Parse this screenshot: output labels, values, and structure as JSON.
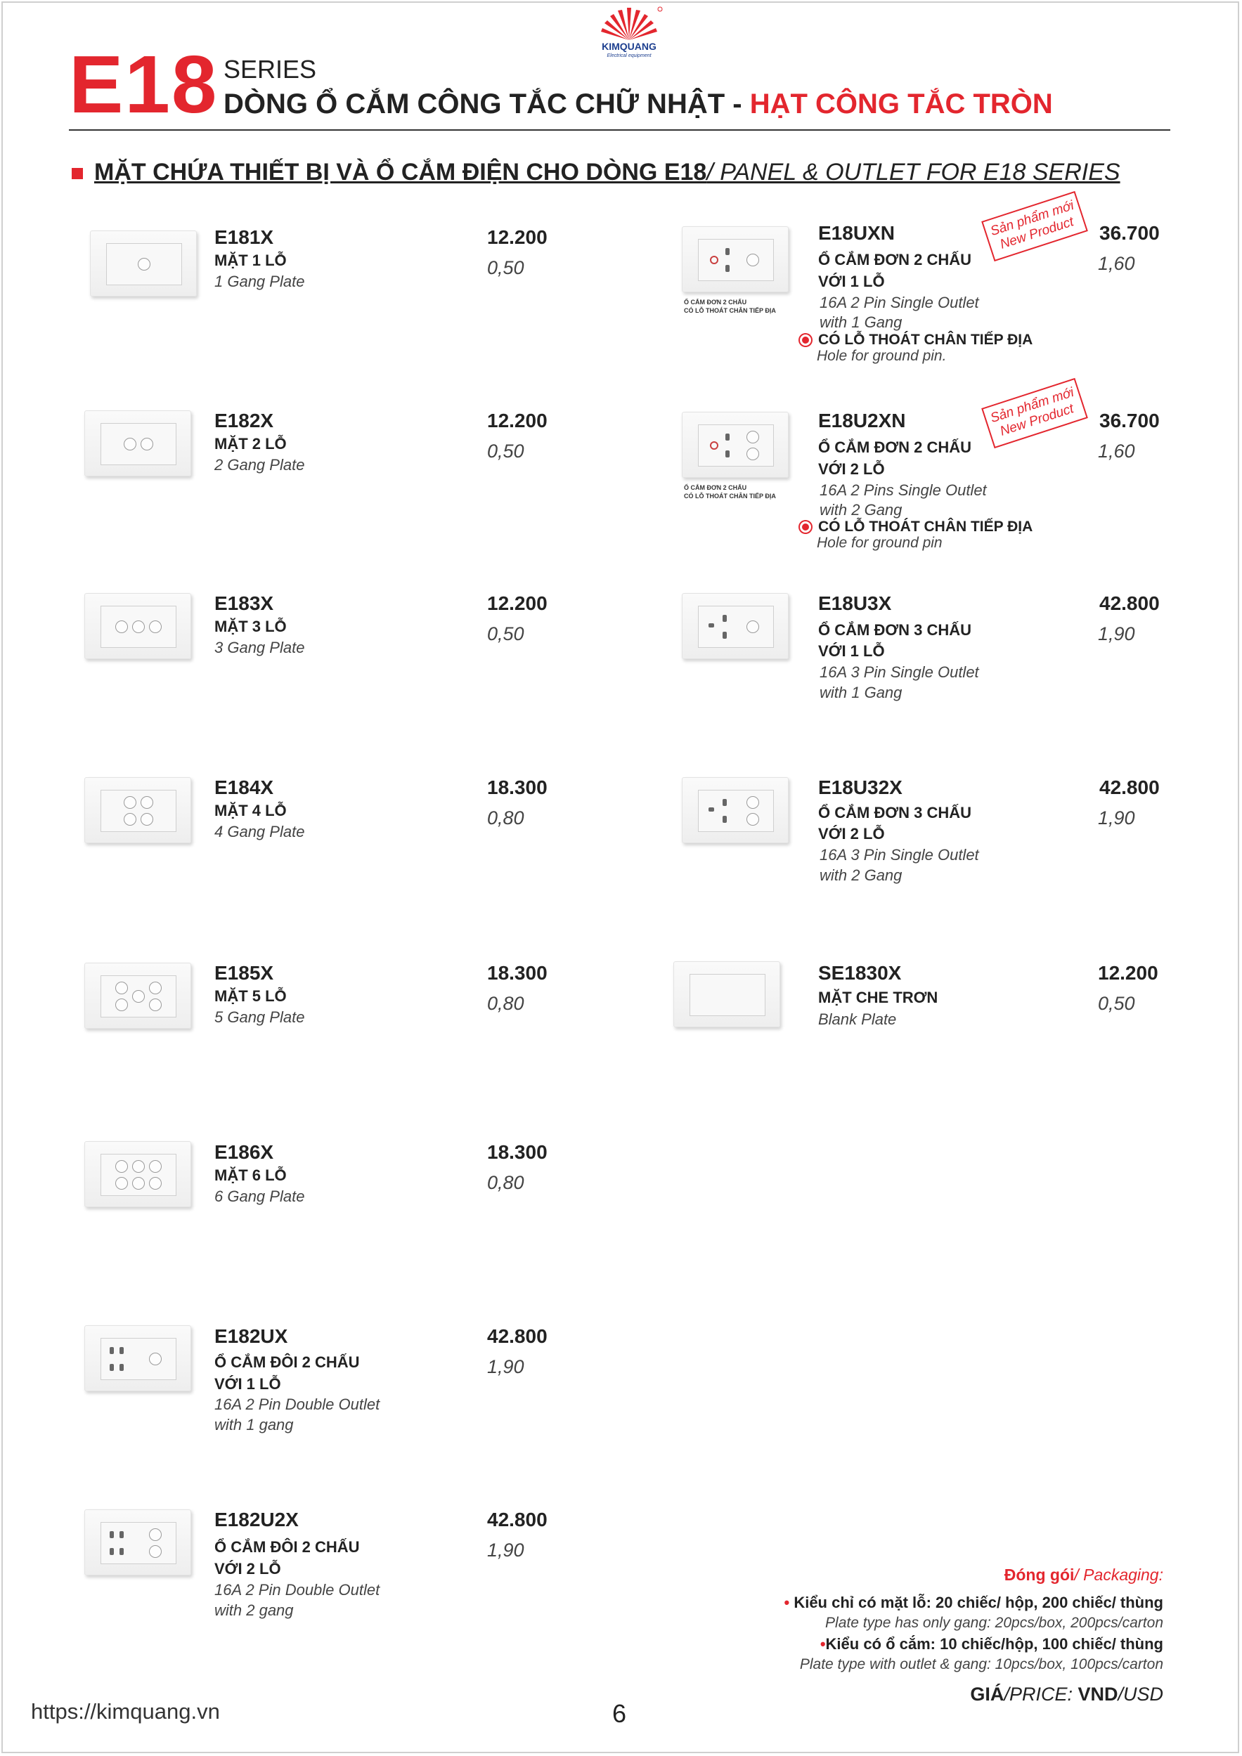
{
  "header": {
    "brand": "KIMQUANG",
    "brand_tagline": "Electrical equipment",
    "series_code": "E18",
    "series_word": "SERIES",
    "title_main": "DÒNG Ổ CẮM CÔNG TẮC CHỮ NHẬT - ",
    "title_accent": "HẠT CÔNG TẮC TRÒN"
  },
  "section": {
    "title_vn": "MẶT CHỨA THIẾT BỊ VÀ Ổ CẮM ĐIỆN CHO DÒNG E18",
    "title_en": "/ PANEL & OUTLET FOR E18 SERIES"
  },
  "products_left": [
    {
      "code": "E181X",
      "name_vn": "MẶT 1 LỖ",
      "name_en": "1 Gang Plate",
      "price": "12.200",
      "usd": "0,50"
    },
    {
      "code": "E182X",
      "name_vn": "MẶT 2 LỖ",
      "name_en": "2 Gang Plate",
      "price": "12.200",
      "usd": "0,50"
    },
    {
      "code": "E183X",
      "name_vn": "MẶT 3 LỖ",
      "name_en": "3 Gang Plate",
      "price": "12.200",
      "usd": "0,50"
    },
    {
      "code": "E184X",
      "name_vn": "MẶT 4 LỖ",
      "name_en": "4 Gang Plate",
      "price": "18.300",
      "usd": "0,80"
    },
    {
      "code": "E185X",
      "name_vn": "MẶT 5 LỖ",
      "name_en": "5 Gang Plate",
      "price": "18.300",
      "usd": "0,80"
    },
    {
      "code": "E186X",
      "name_vn": "MẶT 6 LỖ",
      "name_en": "6 Gang Plate",
      "price": "18.300",
      "usd": "0,80"
    },
    {
      "code": "E182UX",
      "name_vn_1": "Ổ CẮM ĐÔI 2 CHẤU",
      "name_vn_2": "VỚI 1 LỖ",
      "name_en_1": "16A 2 Pin Double Outlet",
      "name_en_2": "with 1 gang",
      "price": "42.800",
      "usd": "1,90"
    },
    {
      "code": "E182U2X",
      "name_vn_1": "Ổ CẮM ĐÔI 2 CHẤU",
      "name_vn_2": "VỚI 2 LỖ",
      "name_en_1": "16A 2 Pin Double Outlet",
      "name_en_2": "with 2 gang",
      "price": "42.800",
      "usd": "1,90"
    }
  ],
  "products_right": [
    {
      "code": "E18UXN",
      "name_vn_1": "Ổ CẮM ĐƠN 2 CHẤU",
      "name_vn_2": "VỚI 1 LỖ",
      "name_en_1": "16A 2 Pin Single Outlet",
      "name_en_2": "with 1 Gang",
      "price": "36.700",
      "usd": "1,60",
      "caption_1": "Ổ CẮM ĐƠN 2 CHẤU",
      "caption_2": "CÓ LỖ THOÁT CHÂN TIẾP ĐỊA",
      "ground_vn": "CÓ LỖ THOÁT CHÂN TIẾP ĐỊA",
      "ground_en": "Hole for ground pin.",
      "stamp_1": "Sản phẩm mới",
      "stamp_2": "New Product"
    },
    {
      "code": "E18U2XN",
      "name_vn_1": "Ổ CẮM ĐƠN 2 CHẤU",
      "name_vn_2": "VỚI 2 LỖ",
      "name_en_1": "16A 2 Pins Single Outlet",
      "name_en_2": "with 2 Gang",
      "price": "36.700",
      "usd": "1,60",
      "caption_1": "Ổ CẮM ĐƠN 2 CHẤU",
      "caption_2": "CÓ LỖ THOÁT CHÂN TIẾP ĐỊA",
      "ground_vn": "CÓ LỖ THOÁT CHÂN TIẾP ĐỊA",
      "ground_en": "Hole for ground pin",
      "stamp_1": "Sản phẩm mới",
      "stamp_2": "New Product"
    },
    {
      "code": "E18U3X",
      "name_vn_1": "Ổ CẮM ĐƠN 3 CHẤU",
      "name_vn_2": "VỚI 1 LỖ",
      "name_en_1": "16A 3 Pin Single Outlet",
      "name_en_2": "with 1 Gang",
      "price": "42.800",
      "usd": "1,90"
    },
    {
      "code": "E18U32X",
      "name_vn_1": "Ổ CẮM ĐƠN 3 CHẤU",
      "name_vn_2": "VỚI 2 LỖ",
      "name_en_1": "16A 3 Pin Single Outlet",
      "name_en_2": "with 2 Gang",
      "price": "42.800",
      "usd": "1,90"
    },
    {
      "code": "SE1830X",
      "name_vn": "MẶT CHE TRƠN",
      "name_en": "Blank Plate",
      "price": "12.200",
      "usd": "0,50"
    }
  ],
  "packaging": {
    "title_vn": "Đóng gói",
    "title_en": "/ Packaging:",
    "bullet": "•",
    "line1_vn": "Kiểu chỉ có mặt lỗ: 20 chiếc/ hộp, 200 chiếc/ thùng",
    "line1_en": "Plate type has only gang: 20pcs/box, 200pcs/carton",
    "line2_vn": "Kiểu có ổ cắm: 10 chiếc/hộp, 100 chiếc/ thùng",
    "line2_en": "Plate type with outlet & gang: 10pcs/box, 100pcs/carton"
  },
  "price_unit": {
    "gia": "GIÁ",
    "price_word": "/PRICE:",
    "vnd": " VND",
    "usd": "/USD"
  },
  "footer": {
    "url": "https://kimquang.vn",
    "page_number": "6"
  },
  "colors": {
    "accent_red": "#e3262e",
    "text_dark": "#222222"
  }
}
